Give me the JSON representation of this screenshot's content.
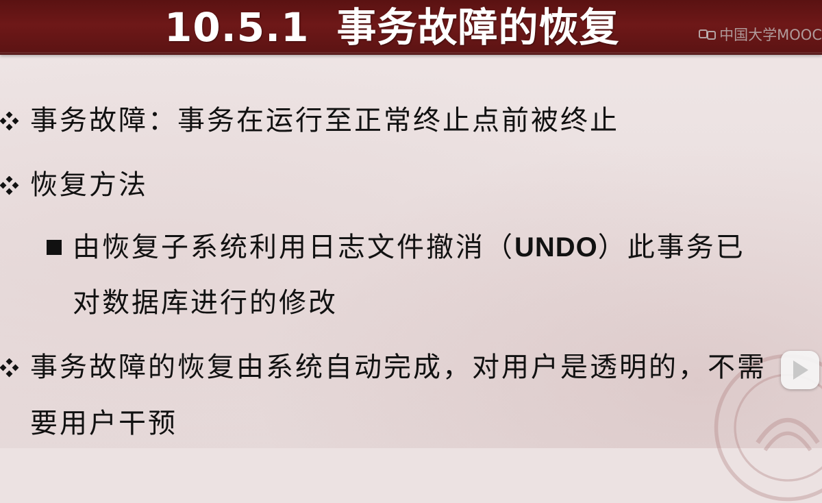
{
  "title": {
    "number": "10.5.1",
    "text": "事务故障的恢复"
  },
  "watermark": {
    "text": "中国大学MOOC",
    "icon": "mooc-logo-icon"
  },
  "bullets": [
    {
      "marker": "diamond-bullet-icon",
      "lines": [
        "事务故障：事务在运行至正常终止点前被终止"
      ]
    },
    {
      "marker": "diamond-bullet-icon",
      "lines": [
        "恢复方法"
      ]
    },
    {
      "marker": "square-bullet-icon",
      "lines_parts": {
        "before": "由恢复子系统利用日志文件撤消（",
        "bold": "UNDO",
        "after": "）此事务已"
      },
      "lines": [
        "对数据库进行的修改"
      ]
    },
    {
      "marker": "diamond-bullet-icon",
      "lines": [
        "事务故障的恢复由系统自动完成，对用户是透明的，不需",
        "要用户干预"
      ]
    }
  ],
  "player": {
    "icon": "play-icon"
  },
  "colors": {
    "title_bar": "#6e1818",
    "title_text": "#ffffff",
    "background": "#ece2e2",
    "body_text": "#111111"
  }
}
